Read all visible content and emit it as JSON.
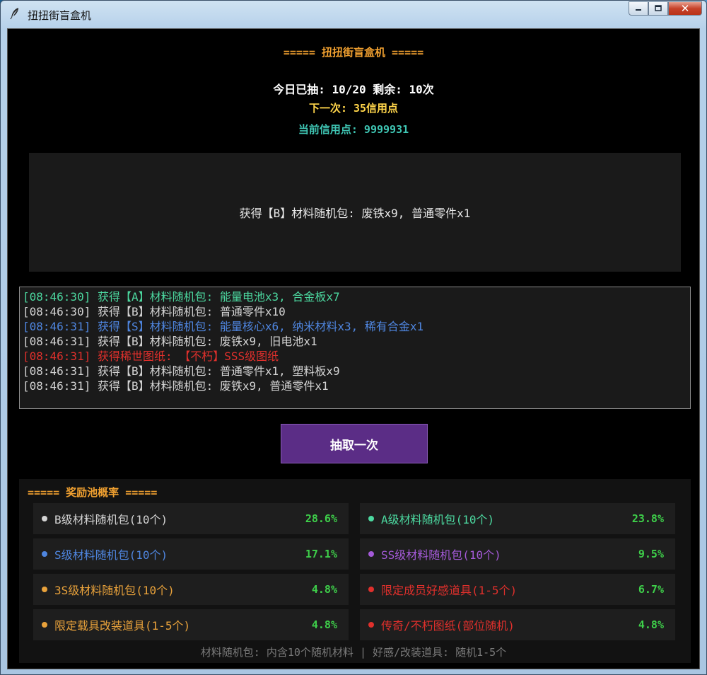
{
  "window": {
    "title": "扭扭街盲盒机",
    "minimize_label": "",
    "maximize_label": "",
    "close_label": "✕"
  },
  "header": {
    "title": "===== 扭扭街盲盒机 =====",
    "draw_count": "今日已抽: 10/20  剩余: 10次",
    "next_cost": "下一次: 35信用点",
    "credits": "当前信用点: 9999931"
  },
  "result": {
    "text": "获得【B】材料随机包: 废铁x9, 普通零件x1"
  },
  "log": [
    {
      "text": "[08:46:30] 获得【A】材料随机包: 能量电池x3, 合金板x7",
      "color": "#4cd9a0"
    },
    {
      "text": "[08:46:30] 获得【B】材料随机包: 普通零件x10",
      "color": "#d4d4d4"
    },
    {
      "text": "[08:46:31] 获得【S】材料随机包: 能量核心x6, 纳米材料x3, 稀有合金x1",
      "color": "#4f86e0"
    },
    {
      "text": "[08:46:31] 获得【B】材料随机包: 废铁x9, 旧电池x1",
      "color": "#d4d4d4"
    },
    {
      "text": "[08:46:31] 获得稀世图纸: 【不朽】SSS级图纸",
      "color": "#e0302c"
    },
    {
      "text": "[08:46:31] 获得【B】材料随机包: 普通零件x1, 塑料板x9",
      "color": "#d4d4d4"
    },
    {
      "text": "[08:46:31] 获得【B】材料随机包: 废铁x9, 普通零件x1",
      "color": "#d4d4d4"
    }
  ],
  "draw_button": {
    "label": "抽取一次"
  },
  "pool": {
    "title": "===== 奖励池概率 =====",
    "items": [
      {
        "name": "B级材料随机包(10个)",
        "rate": "28.6%",
        "color": "#d4d4d4"
      },
      {
        "name": "A级材料随机包(10个)",
        "rate": "23.8%",
        "color": "#4cd9a0"
      },
      {
        "name": "S级材料随机包(10个)",
        "rate": "17.1%",
        "color": "#4f86e0"
      },
      {
        "name": "SS级材料随机包(10个)",
        "rate": "9.5%",
        "color": "#a45ad8"
      },
      {
        "name": "3S级材料随机包(10个)",
        "rate": "4.8%",
        "color": "#e9a23b"
      },
      {
        "name": "限定成员好感道具(1-5个)",
        "rate": "6.7%",
        "color": "#e0302c"
      },
      {
        "name": "限定载具改装道具(1-5个)",
        "rate": "4.8%",
        "color": "#e9a23b"
      },
      {
        "name": "传奇/不朽图纸(部位随机)",
        "rate": "4.8%",
        "color": "#e0302c"
      }
    ],
    "footer": "材料随机包: 内含10个随机材料 | 好感/改装道具: 随机1-5个"
  }
}
